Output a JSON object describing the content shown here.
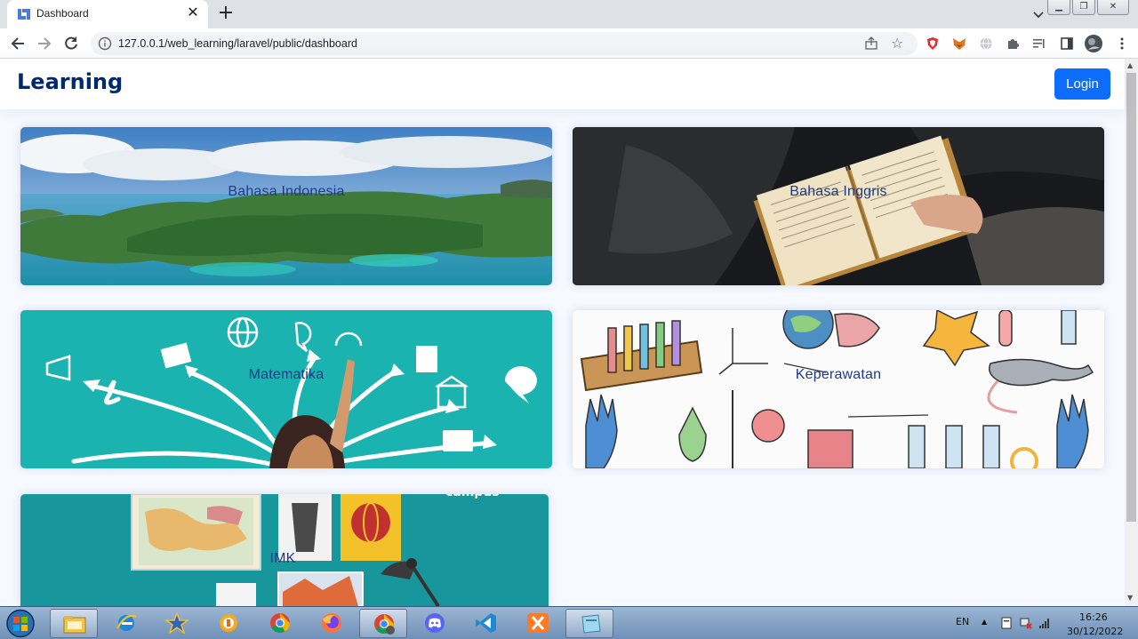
{
  "browser": {
    "tab_title": "Dashboard",
    "url": "127.0.0.1/web_learning/laravel/public/dashboard"
  },
  "navbar": {
    "brand": "Learning",
    "login_label": "Login"
  },
  "courses": [
    {
      "label": "Bahasa Indonesia"
    },
    {
      "label": "Bahasa Inggris"
    },
    {
      "label": "Matematika"
    },
    {
      "label": "Keperawatan"
    },
    {
      "label": "IMK"
    }
  ],
  "taskbar": {
    "language": "EN",
    "time": "16:26",
    "date": "30/12/2022",
    "apps": [
      "file-explorer",
      "internet-explorer",
      "pinned-star",
      "sandbox",
      "chrome",
      "firefox",
      "chrome-profile",
      "discord",
      "vscode",
      "xampp",
      "note-app"
    ]
  },
  "colors": {
    "brand": "#012970",
    "primary": "#0d6efd",
    "page_bg": "#f6f9ff",
    "card_label": "#1f3a8a"
  }
}
